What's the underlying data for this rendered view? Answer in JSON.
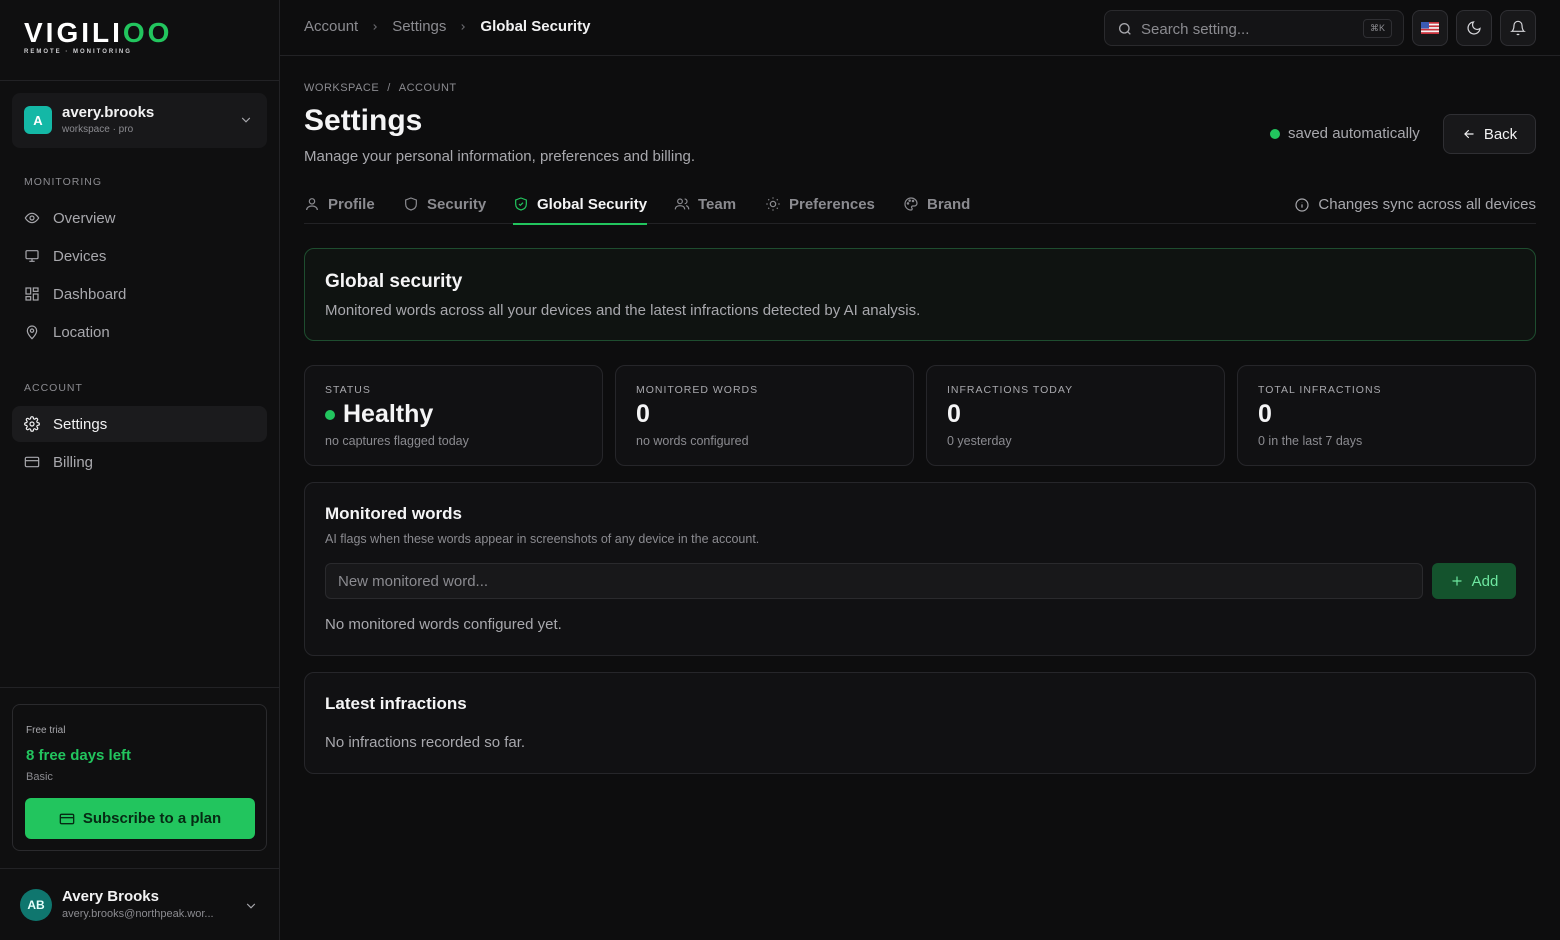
{
  "brand": {
    "name_main": "VIGILI",
    "name_accent": "OO",
    "tagline": "REMOTE · MONITORING"
  },
  "workspace": {
    "avatar": "A",
    "name": "avery.brooks",
    "plan": "workspace · pro"
  },
  "sidebar": {
    "monitoring_label": "MONITORING",
    "monitoring_items": [
      {
        "label": "Overview",
        "icon": "eye-icon"
      },
      {
        "label": "Devices",
        "icon": "monitor-icon"
      },
      {
        "label": "Dashboard",
        "icon": "dashboard-grid-icon"
      },
      {
        "label": "Location",
        "icon": "map-pin-icon"
      }
    ],
    "account_label": "ACCOUNT",
    "account_items": [
      {
        "label": "Settings",
        "icon": "gear-icon",
        "active": true
      },
      {
        "label": "Billing",
        "icon": "credit-card-icon"
      }
    ]
  },
  "trial": {
    "label": "Free trial",
    "days_left": "8 free days left",
    "plan": "Basic",
    "cta": "Subscribe to a plan"
  },
  "user": {
    "initials": "AB",
    "name": "Avery Brooks",
    "email": "avery.brooks@northpeak.wor..."
  },
  "topbar": {
    "breadcrumb": [
      "Account",
      "Settings",
      "Global Security"
    ],
    "search_placeholder": "Search setting...",
    "search_shortcut": "⌘K"
  },
  "page": {
    "kicker": [
      "WORKSPACE",
      "/",
      "ACCOUNT"
    ],
    "title": "Settings",
    "subtitle": "Manage your personal information, preferences and billing.",
    "saved_status": "saved automatically",
    "back_label": "Back",
    "sync_note": "Changes sync across all devices"
  },
  "tabs": [
    {
      "label": "Profile",
      "icon": "user-icon"
    },
    {
      "label": "Security",
      "icon": "shield-icon"
    },
    {
      "label": "Global Security",
      "icon": "shield-check-icon",
      "active": true
    },
    {
      "label": "Team",
      "icon": "users-icon"
    },
    {
      "label": "Preferences",
      "icon": "sun-icon"
    },
    {
      "label": "Brand",
      "icon": "palette-icon"
    }
  ],
  "hero": {
    "title": "Global security",
    "description": "Monitored words across all your devices and the latest infractions detected by AI analysis."
  },
  "stats": [
    {
      "label": "STATUS",
      "value": "Healthy",
      "note": "no captures flagged today"
    },
    {
      "label": "MONITORED WORDS",
      "value": "0",
      "note": "no words configured"
    },
    {
      "label": "INFRACTIONS TODAY",
      "value": "0",
      "note": "0 yesterday"
    },
    {
      "label": "TOTAL INFRACTIONS",
      "value": "0",
      "note": "0 in the last 7 days"
    }
  ],
  "monitored_words": {
    "title": "Monitored words",
    "description": "AI flags when these words appear in screenshots of any device in the account.",
    "input_placeholder": "New monitored word...",
    "add_label": "Add",
    "empty": "No monitored words configured yet."
  },
  "infractions": {
    "title": "Latest infractions",
    "empty": "No infractions recorded so far."
  },
  "colors": {
    "accent": "#22c55e",
    "background": "#0d0d0e",
    "panel": "#111113"
  }
}
